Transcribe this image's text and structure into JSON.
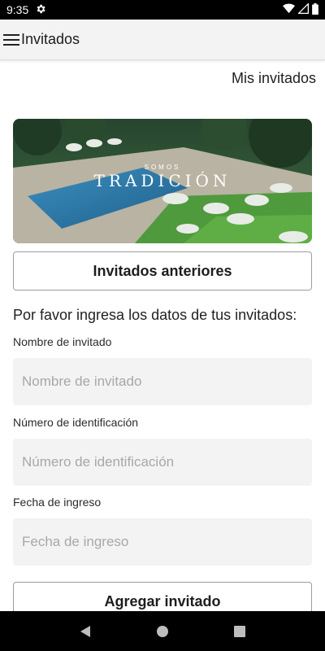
{
  "status_bar": {
    "time": "9:35",
    "icons": [
      "settings-icon",
      "wifi-icon",
      "signal-icon",
      "battery-icon"
    ]
  },
  "app_bar": {
    "title": "Invitados",
    "menu_icon": "hamburger-menu-icon",
    "background": "#f3f3f3"
  },
  "header_link": "Mis invitados",
  "banner": {
    "subtitle": "SOMOS",
    "title": "TRADICIÓN"
  },
  "buttons": {
    "anteriores": "Invitados anteriores",
    "agregar": "Agregar invitado"
  },
  "form": {
    "instructions": "Por favor ingresa los datos de tus invitados:",
    "fields": [
      {
        "label": "Nombre de invitado",
        "placeholder": "Nombre de invitado",
        "value": ""
      },
      {
        "label": "Número de identificación",
        "placeholder": "Número de identificación",
        "value": ""
      },
      {
        "label": "Fecha de ingreso",
        "placeholder": "Fecha de ingreso",
        "value": ""
      }
    ]
  },
  "nav_bar": {
    "icons": [
      "back-icon",
      "home-icon",
      "recents-icon"
    ]
  },
  "colors": {
    "field_background": "#f3f3f3",
    "button_border": "#9c9c9c",
    "placeholder": "#a8a8a8"
  }
}
